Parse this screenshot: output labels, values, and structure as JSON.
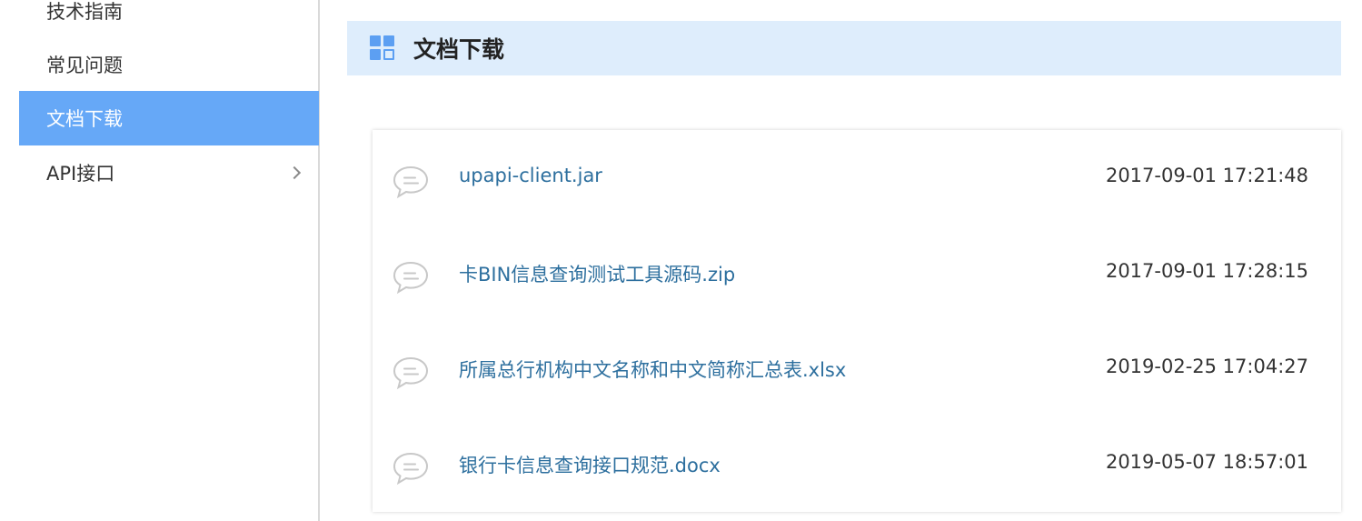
{
  "sidebar": {
    "items": [
      {
        "label": "技术指南",
        "active": false
      },
      {
        "label": "常见问题",
        "active": false
      },
      {
        "label": "文档下载",
        "active": true
      },
      {
        "label": "API接口",
        "active": false,
        "has_submenu": true
      }
    ]
  },
  "section": {
    "title": "文档下载",
    "icon": "grid-icon"
  },
  "files": [
    {
      "name": "upapi-client.jar",
      "date": "2017-09-01 17:21:48",
      "icon": "chat-bubble-icon"
    },
    {
      "name": "卡BIN信息查询测试工具源码.zip",
      "date": "2017-09-01 17:28:15",
      "icon": "chat-bubble-icon"
    },
    {
      "name": "所属总行机构中文名称和中文简称汇总表.xlsx",
      "date": "2019-02-25 17:04:27",
      "icon": "chat-bubble-icon"
    },
    {
      "name": "银行卡信息查询接口规范.docx",
      "date": "2019-05-07 18:57:01",
      "icon": "chat-bubble-icon"
    }
  ],
  "colors": {
    "active_nav": "#66a8f7",
    "header_bg": "#deedfc",
    "link": "#2d6f9e",
    "icon_blue": "#5c9ff2"
  }
}
